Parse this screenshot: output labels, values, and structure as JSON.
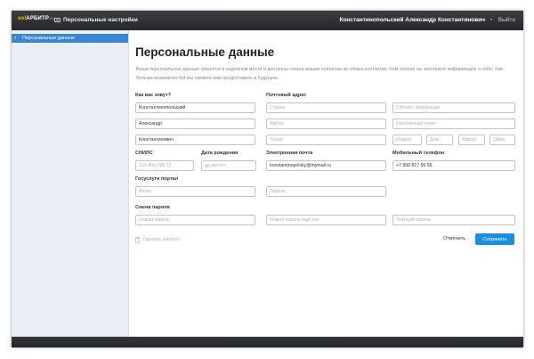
{
  "header": {
    "logo_part1": "sol",
    "logo_part2": "АРБИТР",
    "logo_part3": "365",
    "settings_link": "Персональные настройки",
    "user_name": "Константинопольский Александр Константинович",
    "separator": "•",
    "logout": "Выйти"
  },
  "sidebar": {
    "items": [
      {
        "label": "Персональные данные",
        "active": true
      }
    ]
  },
  "main": {
    "title": "Персональные данные",
    "description": "Ваши персональные данные хранятся в надежном месте и доступны только вашим коллегам из списка контактов. Чем полнее вы заполните информацию о себе, тем больше возможностей мы сможем вам предоставить в будущем."
  },
  "form": {
    "name_label": "Как вас зовут?",
    "last_name": "Константинопольский",
    "first_name": "Александр",
    "middle_name": "Константинович",
    "address_label": "Почтовый адрес",
    "country_placeholder": "Страна",
    "region_placeholder": "Субъект федерации",
    "district_placeholder": "Район",
    "locality_placeholder": "Населенный пункт",
    "street_placeholder": "Улица",
    "index_placeholder": "Индекс",
    "house_placeholder": "Дом",
    "building_placeholder": "Корпус",
    "office_placeholder": "Офис",
    "snils_label": "СНИЛС",
    "snils_placeholder": "123-456-789 12",
    "birthdate_label": "Дата рождения",
    "birthdate_placeholder": "дд.мм.гггг",
    "email_label": "Электронная почта",
    "email_value": "konstantinopolsky@mymail.ru",
    "phone_label": "Мобильный телефон",
    "phone_value": "+7 999 817 56 56",
    "portal_label": "Госуслуги портал",
    "login_placeholder": "Логин",
    "password_placeholder": "Пароль",
    "change_password_label": "Смена пароля",
    "new_password_placeholder": "Новый пароль",
    "repeat_password_placeholder": "Новый пароль еще раз",
    "current_password_placeholder": "Текущий пароль"
  },
  "actions": {
    "delete_account": "Удалить аккаунт",
    "cancel": "Отменить",
    "save": "Сохранить"
  },
  "colors": {
    "topbar": "#2f3236",
    "sidebar_active": "#3b86cf",
    "sidebar_bg": "#e9eef4",
    "primary_button": "#1a8ee0",
    "logo_accent": "#f2c12e"
  }
}
